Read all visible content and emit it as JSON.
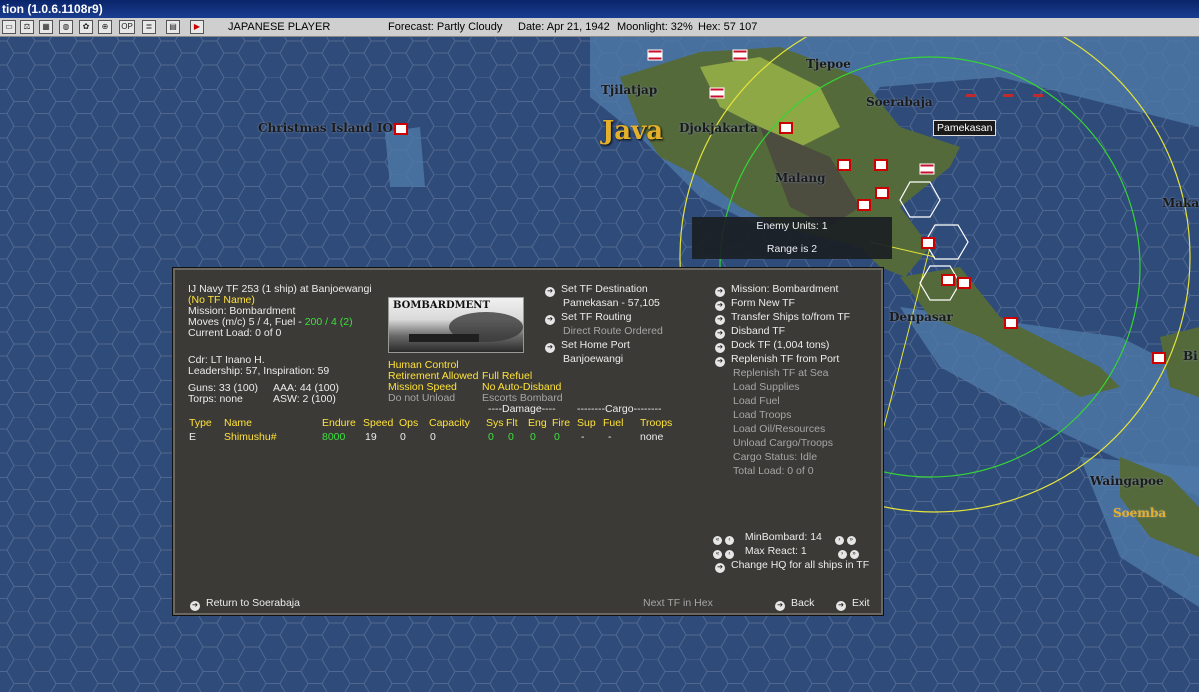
{
  "window": {
    "title": "tion (1.0.6.1108r9)"
  },
  "toolbar": {
    "player": "JAPANESE PLAYER",
    "forecast": "Forecast: Partly Cloudy",
    "date": "Date: Apr 21, 1942",
    "moonlight": "Moonlight: 32%",
    "hex": "Hex: 57 107",
    "icons": [
      "save-icon",
      "scale-icon",
      "chart-icon",
      "globe-icon",
      "gear-icon",
      "grid-icon",
      "op-icon",
      "list-icon",
      "play-icon"
    ]
  },
  "map": {
    "labels": [
      "Christmas Island IO",
      "Java",
      "Tjilatjap",
      "Djokjakarta",
      "Tjepoe",
      "Soerabaja",
      "Malang",
      "Denpasar",
      "Makas",
      "Waingapoe",
      "Soemba",
      "Bi"
    ],
    "hex_tooltip": "Pamekasan",
    "enemy_box": {
      "line1": "Enemy Units: 1",
      "line2": "Range is 2"
    }
  },
  "panel": {
    "header": {
      "title": "IJ Navy TF 253 (1 ship) at Banjoewangi",
      "tf_name": "(No TF Name)",
      "mission": "Mission: Bombardment",
      "moves_prefix": "Moves (m/c) 5 / 4, Fuel - ",
      "moves_fuel": "200 / 4 (2)",
      "current_load": "Current Load: 0 of 0"
    },
    "commander": {
      "cdr": "Cdr: LT  Inano H.",
      "leadership": "Leadership: 57, Inspiration: 59",
      "guns": "Guns: 33 (100)",
      "aaa": "AAA: 44 (100)",
      "torps": "Torps: none",
      "asw": "ASW: 2 (100)"
    },
    "image_caption": "BOMBARDMENT",
    "flags": {
      "human_control": "Human Control",
      "full_refuel": "Full Refuel",
      "retirement": "Retirement Allowed",
      "auto_disband": "No Auto-Disband",
      "mission_speed": "Mission Speed",
      "escorts": "Escorts Bombard",
      "unload": "Do not Unload"
    },
    "routing": {
      "set_destination": "Set TF Destination",
      "destination": "Pamekasan - 57,105",
      "set_routing": "Set TF Routing",
      "route_type": "Direct Route Ordered",
      "set_home": "Set Home Port",
      "home_port": "Banjoewangi"
    },
    "actions": [
      {
        "label": "Mission: Bombardment",
        "enabled": true
      },
      {
        "label": "Form New TF",
        "enabled": true
      },
      {
        "label": "Transfer Ships to/from TF",
        "enabled": true
      },
      {
        "label": "Disband TF",
        "enabled": true
      },
      {
        "label": "Dock TF (1,004 tons)",
        "enabled": true
      },
      {
        "label": "Replenish TF from Port",
        "enabled": true
      },
      {
        "label": "Replenish TF at Sea",
        "enabled": false
      },
      {
        "label": "Load Supplies",
        "enabled": false
      },
      {
        "label": "Load Fuel",
        "enabled": false
      },
      {
        "label": "Load Troops",
        "enabled": false
      },
      {
        "label": "Load Oil/Resources",
        "enabled": false
      },
      {
        "label": "Unload Cargo/Troops",
        "enabled": false
      },
      {
        "label": "Cargo Status: Idle",
        "enabled": false
      },
      {
        "label": "Total Load: 0 of 0",
        "enabled": false
      }
    ],
    "table": {
      "damage_header": "----Damage----",
      "cargo_header": "--------Cargo--------",
      "columns": [
        "Type",
        "Name",
        "Endure",
        "Speed",
        "Ops",
        "Capacity",
        "Sys",
        "Flt",
        "Eng",
        "Fire",
        "Sup",
        "Fuel",
        "Troops"
      ],
      "rows": [
        {
          "Type": "E",
          "Name": "Shimushu#",
          "Endure": "8000",
          "Speed": "19",
          "Ops": "0",
          "Capacity": "0",
          "Sys": "0",
          "Flt": "0",
          "Eng": "0",
          "Fire": "0",
          "Sup": "-",
          "Fuel": "-",
          "Troops": "none"
        }
      ]
    },
    "settings": {
      "min_bombard": "MinBombard: 14",
      "max_react": "Max React: 1",
      "change_hq": "Change HQ for all ships in TF"
    },
    "footer": {
      "return": "Return to Soerabaja",
      "next_tf": "Next TF in Hex",
      "back": "Back",
      "exit": "Exit"
    }
  }
}
